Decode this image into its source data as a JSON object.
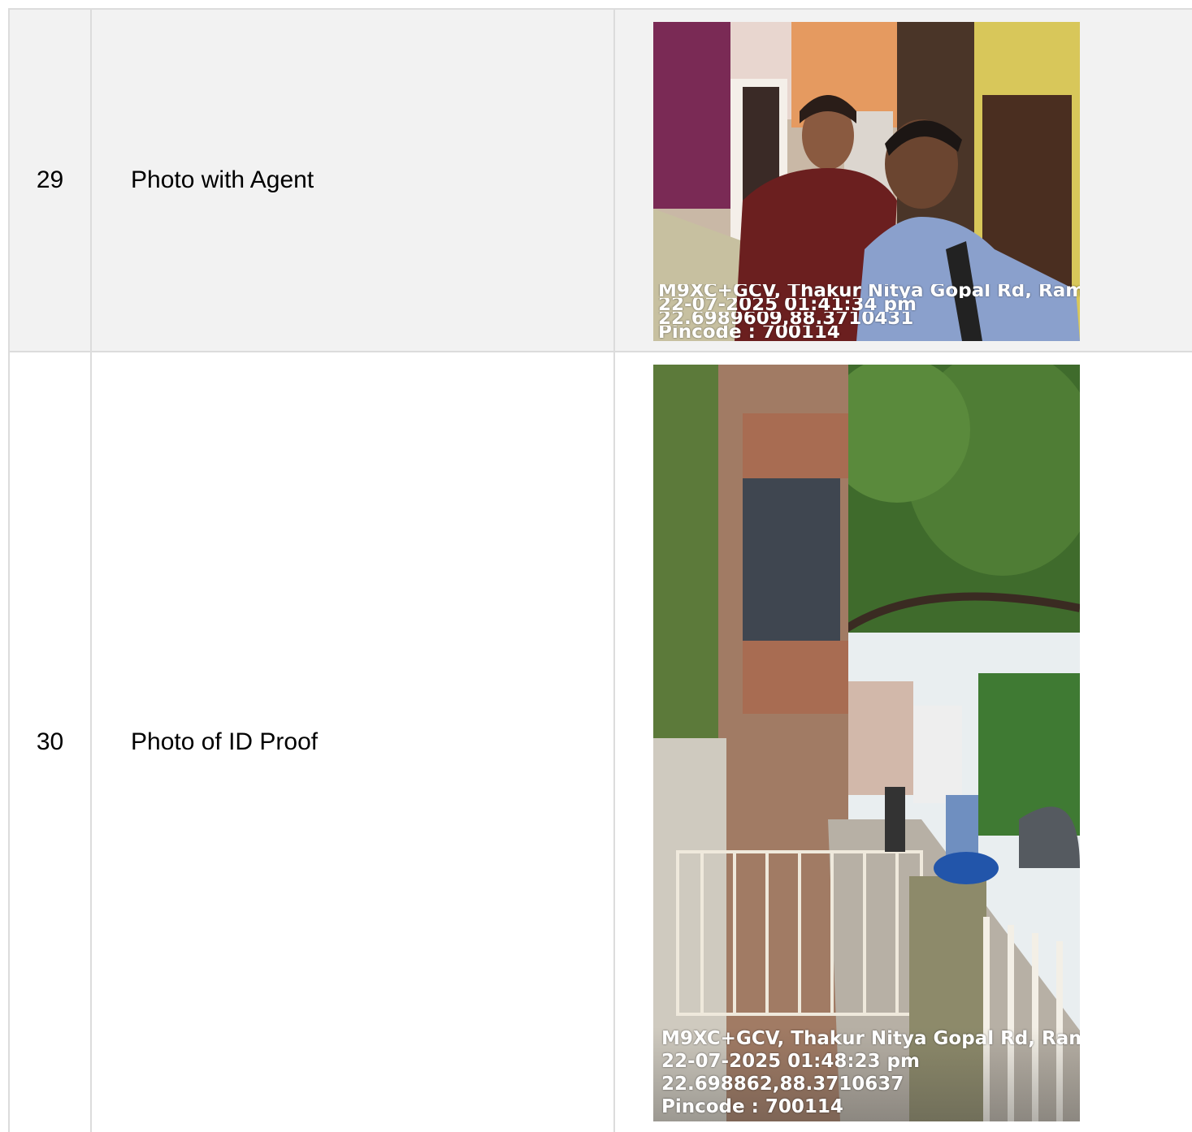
{
  "rows": [
    {
      "number": "29",
      "label": "Photo with Agent",
      "stamp": {
        "address": "M9XC+GCV, Thakur Nitya Gopal Rd, Ram",
        "datetime": "22-07-2025 01:41:34 pm",
        "coords": "22.6989609,88.3710431",
        "pincode": "Pincode : 700114"
      }
    },
    {
      "number": "30",
      "label": "Photo of ID Proof",
      "stamp": {
        "address": "M9XC+GCV, Thakur Nitya Gopal Rd, Ram",
        "datetime": "22-07-2025 01:48:23 pm",
        "coords": "22.698862,88.3710637",
        "pincode": "Pincode : 700114"
      }
    }
  ]
}
